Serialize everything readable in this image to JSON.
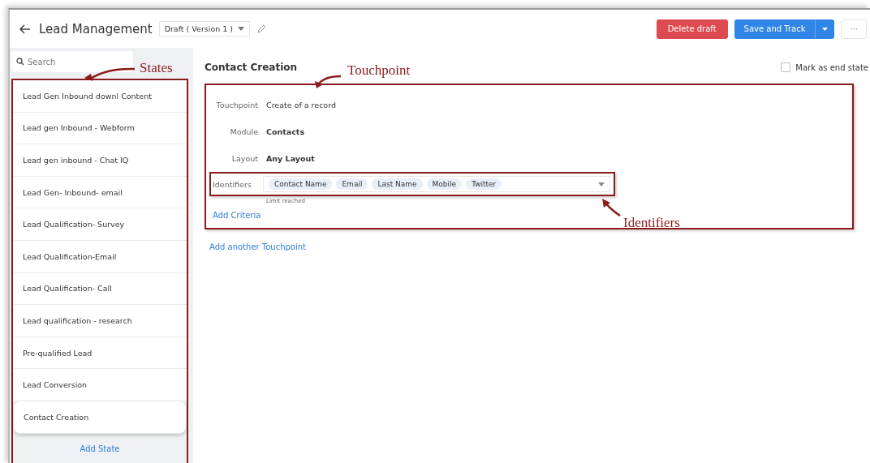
{
  "header": {
    "title": "Lead Management",
    "version": "Draft ( Version 1 )",
    "buttons": [
      {
        "label": "Delete draft",
        "kind": "danger"
      },
      {
        "label": "Save and Track",
        "kind": "primary"
      },
      {
        "label": "···",
        "kind": "more"
      }
    ]
  },
  "sidebar": {
    "search": {
      "placeholder": "Search"
    },
    "items": [
      {
        "label": "Lead Gen Inbound downl Content",
        "selected": false
      },
      {
        "label": "Lead gen Inbound - Webform",
        "selected": false
      },
      {
        "label": "Lead gen inbound - Chat IQ",
        "selected": false
      },
      {
        "label": "Lead Gen- Inbound- email",
        "selected": false
      },
      {
        "label": "Lead Qualification- Survey",
        "selected": false
      },
      {
        "label": "Lead Qualification-Email",
        "selected": false
      },
      {
        "label": "Lead Qualification- Call",
        "selected": false
      },
      {
        "label": "Lead qualification - research",
        "selected": false
      },
      {
        "label": "Pre-qualified Lead",
        "selected": false
      },
      {
        "label": "Lead Conversion",
        "selected": false
      },
      {
        "label": "Contact Creation",
        "selected": true
      }
    ],
    "add_state": "Add State"
  },
  "main": {
    "title": "Contact Creation",
    "end_state": {
      "label": "Mark as end state",
      "checked": false
    },
    "touchpoint": {
      "fields": [
        {
          "label": "Touchpoint",
          "value": "Create of a record"
        },
        {
          "label": "Module",
          "value": "Contacts"
        },
        {
          "label": "Layout",
          "value": "Any Layout"
        }
      ],
      "identifiers": {
        "label": "Identifiers",
        "tags": [
          "Contact Name",
          "Email",
          "Last Name",
          "Mobile",
          "Twitter"
        ],
        "hint": "Limit reached"
      },
      "add_criteria": "Add Criteria"
    },
    "add_touchpoint": "Add another Touchpoint"
  },
  "annotations": [
    {
      "text": "States"
    },
    {
      "text": "Touchpoint"
    },
    {
      "text": "Identifiers"
    }
  ]
}
